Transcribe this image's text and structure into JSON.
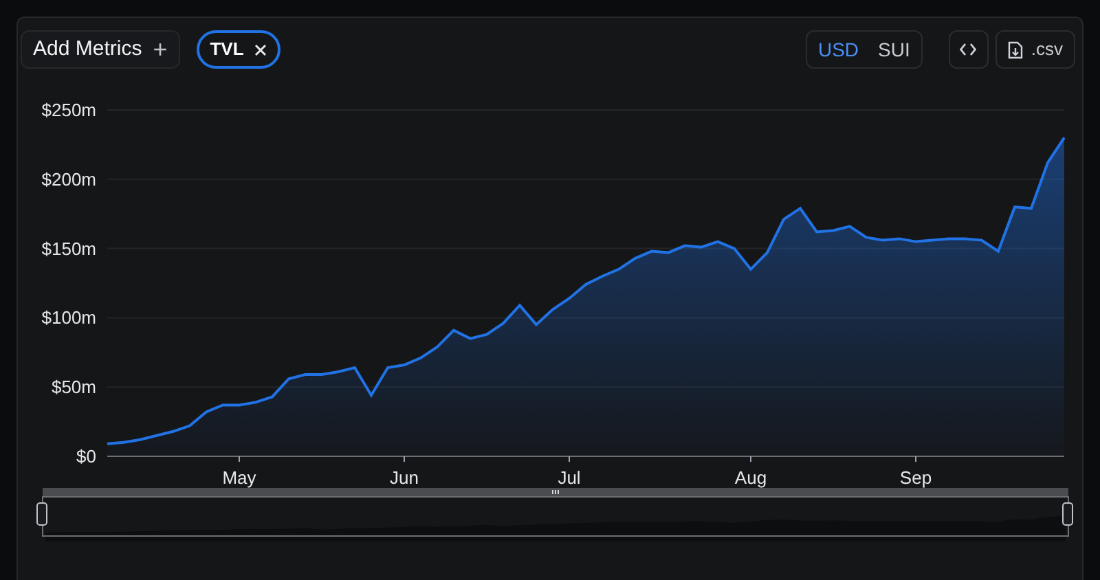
{
  "toolbar": {
    "add_button": "Add Metrics",
    "add_icon": "+",
    "metrics": [
      {
        "label": "TVL",
        "selected": true
      }
    ],
    "currency": [
      {
        "label": "USD",
        "selected": true
      },
      {
        "label": "SUI",
        "selected": false
      }
    ],
    "csv_button": ".csv"
  },
  "chart": {
    "chart_data": {
      "type": "area",
      "grid": true,
      "ylim": [
        0,
        250
      ],
      "yticks": [
        {
          "value": 0,
          "label": "$0"
        },
        {
          "value": 50,
          "label": "$50m"
        },
        {
          "value": 100,
          "label": "$100m"
        },
        {
          "value": 150,
          "label": "$150m"
        },
        {
          "value": 200,
          "label": "$200m"
        },
        {
          "value": 250,
          "label": "$250m"
        }
      ],
      "categories": [
        null,
        null,
        null,
        null,
        null,
        null,
        null,
        null,
        "May",
        null,
        null,
        null,
        null,
        null,
        null,
        null,
        null,
        null,
        "Jun",
        null,
        null,
        null,
        null,
        null,
        null,
        null,
        null,
        null,
        "Jul",
        null,
        null,
        null,
        null,
        null,
        null,
        null,
        null,
        null,
        null,
        "Aug",
        null,
        null,
        null,
        null,
        null,
        null,
        null,
        null,
        null,
        "Sep",
        null,
        null,
        null,
        null,
        null,
        null,
        null,
        null,
        null
      ],
      "series": [
        {
          "color": "#2172e5",
          "values": [
            9,
            10,
            12,
            15,
            18,
            22,
            32,
            37,
            37,
            39,
            43,
            56,
            59,
            59,
            61,
            64,
            44,
            64,
            66,
            71,
            79,
            91,
            85,
            88,
            96,
            109,
            95,
            106,
            114,
            124,
            130,
            135,
            143,
            148,
            147,
            152,
            151,
            155,
            150,
            135,
            147,
            171,
            179,
            162,
            163,
            166,
            158,
            156,
            157,
            155,
            156,
            157,
            157,
            156,
            148,
            180,
            179,
            212,
            230
          ]
        }
      ]
    }
  }
}
